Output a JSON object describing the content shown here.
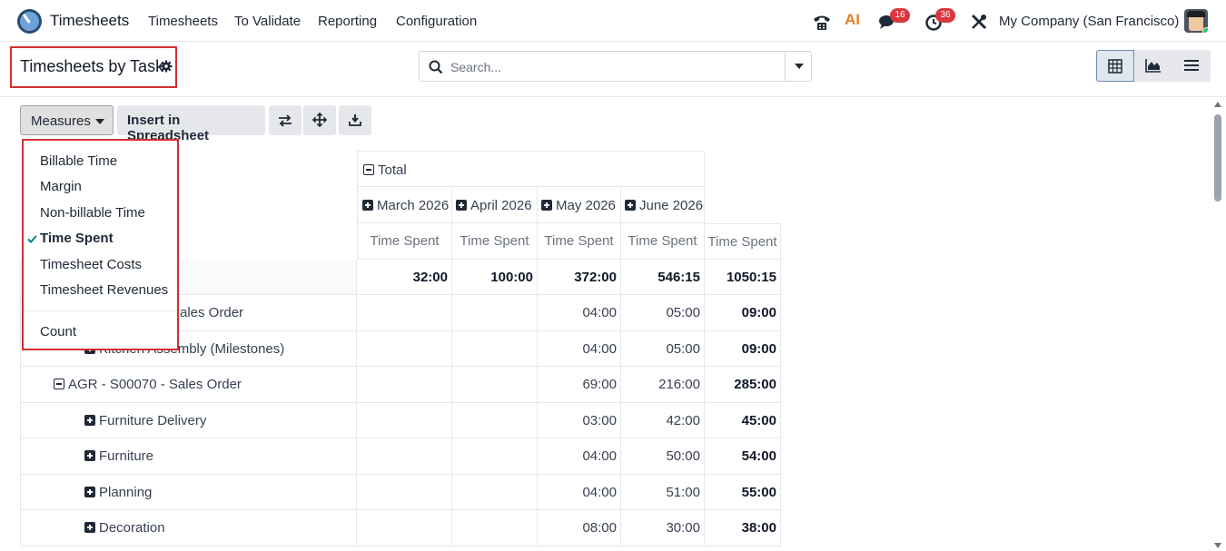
{
  "navbar": {
    "app_name": "Timesheets",
    "menu": [
      "Timesheets",
      "To Validate",
      "Reporting",
      "Configuration"
    ],
    "messages_badge": "16",
    "activities_badge": "36",
    "company": "My Company (San Francisco)",
    "ai_label": "AI"
  },
  "control_panel": {
    "title": "Timesheets by Task",
    "search_placeholder": "Search..."
  },
  "toolbar": {
    "measures_label": "Measures",
    "insert_label": "Insert in Spreadsheet"
  },
  "measures_dropdown": {
    "items": [
      "Billable Time",
      "Margin",
      "Non-billable Time",
      "Time Spent",
      "Timesheet Costs",
      "Timesheet Revenues"
    ],
    "checked": "Time Spent",
    "count_label": "Count"
  },
  "pivot": {
    "total_label": "Total",
    "months": [
      "March 2026",
      "April 2026",
      "May 2026",
      "June 2026"
    ],
    "measure_label": "Time Spent",
    "totals_row": [
      "32:00",
      "100:00",
      "372:00",
      "546:15",
      "1050:15"
    ],
    "rows": [
      {
        "label": "ales Order",
        "values": [
          "",
          "",
          "04:00",
          "05:00",
          "09:00"
        ]
      },
      {
        "label": "Kitchen Assembly (Milestones)",
        "values": [
          "",
          "",
          "04:00",
          "05:00",
          "09:00"
        ]
      },
      {
        "label": "AGR - S00070 - Sales Order",
        "values": [
          "",
          "",
          "69:00",
          "216:00",
          "285:00"
        ]
      },
      {
        "label": "Furniture Delivery",
        "values": [
          "",
          "",
          "03:00",
          "42:00",
          "45:00"
        ]
      },
      {
        "label": "Furniture",
        "values": [
          "",
          "",
          "04:00",
          "50:00",
          "54:00"
        ]
      },
      {
        "label": "Planning",
        "values": [
          "",
          "",
          "04:00",
          "51:00",
          "55:00"
        ]
      },
      {
        "label": "Decoration",
        "values": [
          "",
          "",
          "08:00",
          "30:00",
          "38:00"
        ]
      }
    ]
  }
}
